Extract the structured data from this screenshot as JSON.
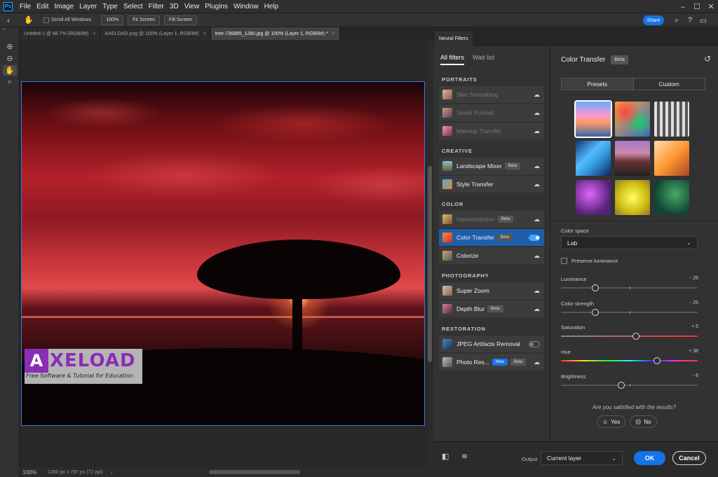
{
  "menu": {
    "logo": "Ps",
    "items": [
      "File",
      "Edit",
      "Image",
      "Layer",
      "Type",
      "Select",
      "Filter",
      "3D",
      "View",
      "Plugins",
      "Window",
      "Help"
    ]
  },
  "options_bar": {
    "scroll_all_windows": "Scroll All Windows",
    "zoom_100": "100%",
    "fit_screen": "Fit Screen",
    "fill_screen": "Fill Screen",
    "share": "Share"
  },
  "doc_tabs": [
    {
      "label": "Untitled-1 @ 66.7% (RGB/8#)"
    },
    {
      "label": "AXELOAD.png @ 100% (Layer 1, RGB/8#)"
    },
    {
      "label": "tree-736885_1280.jpg @ 100% (Layer 1, RGB/8#) *"
    }
  ],
  "watermark": {
    "logo_letter": "A",
    "title": "XELOAD",
    "subtitle": "Free Software & Tutorial for Education"
  },
  "status": {
    "zoom": "100%",
    "doc_info": "1280 px x 797 px (72 ppi)"
  },
  "neural_filters": {
    "panel_tab": "Neural Filters",
    "tabs": [
      "All filters",
      "Wait list"
    ],
    "sections": {
      "portraits": "PORTRAITS",
      "creative": "CREATIVE",
      "color": "COLOR",
      "photography": "PHOTOGRAPHY",
      "restoration": "RESTORATION"
    },
    "filters": {
      "skin_smoothing": "Skin Smoothing",
      "smart_portrait": "Smart Portrait",
      "makeup_transfer": "Makeup Transfer",
      "landscape_mixer": "Landscape Mixer",
      "style_transfer": "Style Transfer",
      "harmonization": "Harmonization",
      "color_transfer": "Color Transfer",
      "colorize": "Colorize",
      "super_zoom": "Super Zoom",
      "depth_blur": "Depth Blur",
      "jpeg_artifacts": "JPEG Artifacts Removal",
      "photo_restoration": "Photo Res..."
    },
    "badges": {
      "beta": "Beta",
      "new": "New"
    }
  },
  "settings": {
    "title": "Color Transfer",
    "title_badge": "Beta",
    "seg_presets": "Presets",
    "seg_custom": "Custom",
    "color_space_label": "Color space",
    "color_space_value": "Lab",
    "preserve_luminance": "Preserve luminance",
    "sliders": {
      "luminance": {
        "label": "Luminance",
        "value": "- 25",
        "level": 0.25
      },
      "color_strength": {
        "label": "Color strength",
        "value": "- 25",
        "level": 0.25
      },
      "saturation": {
        "label": "Saturation",
        "value": "+ 5",
        "level": 0.55
      },
      "hue": {
        "label": "Hue",
        "value": "+ 38",
        "level": 0.705
      },
      "brightness": {
        "label": "Brightness",
        "value": "- 6",
        "level": 0.44
      }
    },
    "feedback_q": "Are you satisfied with the results?",
    "yes": "Yes",
    "no": "No"
  },
  "footer": {
    "output_label": "Output",
    "output_value": "Current layer",
    "ok": "OK",
    "cancel": "Cancel"
  },
  "colors": {
    "accent": "#1473e6",
    "selected_filter": "#1f5ea8",
    "toggle_on": "#4ea1ff"
  }
}
